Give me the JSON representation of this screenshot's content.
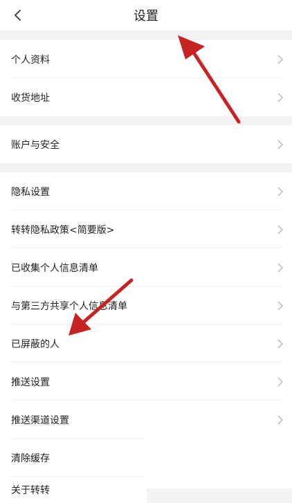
{
  "header": {
    "title": "设置"
  },
  "sections": [
    {
      "items": [
        {
          "label": "个人资料"
        },
        {
          "label": "收货地址"
        }
      ]
    },
    {
      "items": [
        {
          "label": "账户与安全"
        }
      ]
    },
    {
      "items": [
        {
          "label": "隐私设置"
        },
        {
          "label": "转转隐私政策<简要版>"
        },
        {
          "label": "已收集个人信息清单"
        },
        {
          "label": "与第三方共享个人信息清单"
        },
        {
          "label": "已屏蔽的人"
        },
        {
          "label": "推送设置"
        },
        {
          "label": "推送渠道设置"
        },
        {
          "label": "清除缓存"
        },
        {
          "label": "关于转转"
        }
      ]
    }
  ],
  "colors": {
    "background": "#ffffff",
    "divider": "#f2f2f2",
    "annotation_arrow": "#c82323"
  },
  "icons": [
    "back-arrow-icon",
    "chevron-right-icon"
  ]
}
